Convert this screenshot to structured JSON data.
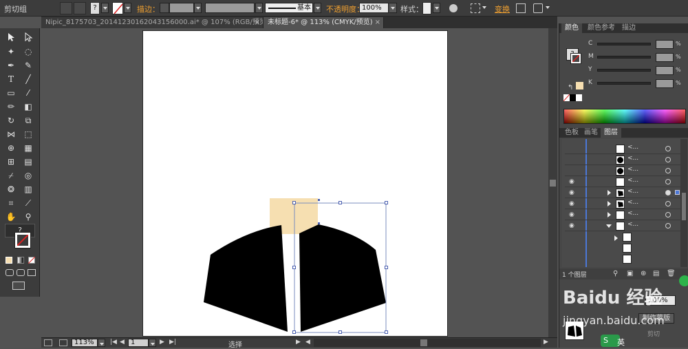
{
  "control_bar": {
    "group_label": "剪切组",
    "stroke_label": "描边：",
    "stroke_style": "基本",
    "opacity_label": "不透明度：",
    "opacity_value": "100%",
    "style_label": "样式：",
    "transform_label": "变换",
    "fill_question": "?"
  },
  "tabs": [
    {
      "label": "Nipic_8175703_20141230162043156000.ai* @ 107% (RGB/预览)",
      "active": false,
      "close": "×"
    },
    {
      "label": "未标题-6* @ 113% (CMYK/预览)",
      "active": true,
      "close": "×"
    }
  ],
  "tools": {
    "fill_question": "?",
    "type_glyph": "T"
  },
  "color_panel": {
    "tabs": [
      "颜色",
      "颜色参考",
      "描边"
    ],
    "channels": [
      {
        "name": "C",
        "unit": "%"
      },
      {
        "name": "M",
        "unit": "%"
      },
      {
        "name": "Y",
        "unit": "%"
      },
      {
        "name": "K",
        "unit": "%"
      }
    ],
    "question": "?",
    "accent_color": "#f6dfb1"
  },
  "layers_panel": {
    "tabs": [
      "色板",
      "画笔",
      "图层"
    ],
    "rows": [
      {
        "name": "<...",
        "eye": false,
        "expand": "none",
        "thumb": "white"
      },
      {
        "name": "<...",
        "eye": false,
        "expand": "none",
        "thumb": "dot"
      },
      {
        "name": "<...",
        "eye": false,
        "expand": "none",
        "thumb": "dot"
      },
      {
        "name": "<...",
        "eye": true,
        "expand": "none",
        "thumb": "white"
      },
      {
        "name": "<...",
        "eye": true,
        "expand": "right",
        "thumb": "shape"
      },
      {
        "name": "<...",
        "eye": true,
        "expand": "right",
        "thumb": "shape"
      },
      {
        "name": "<...",
        "eye": true,
        "expand": "right",
        "thumb": "white"
      },
      {
        "name": "<...",
        "eye": true,
        "expand": "down",
        "thumb": "white"
      }
    ],
    "footer": "1 个图层"
  },
  "appearance_panel": {
    "opacity_value": "100%",
    "mask_button": "制作蒙版",
    "fill_label": "英",
    "clip_label": "剪切"
  },
  "status_bar": {
    "zoom": "113%",
    "page": "1",
    "tool_name": "选择"
  },
  "watermark": {
    "brand": "Baidu 经验",
    "url": "jingyan.baidu.com"
  }
}
